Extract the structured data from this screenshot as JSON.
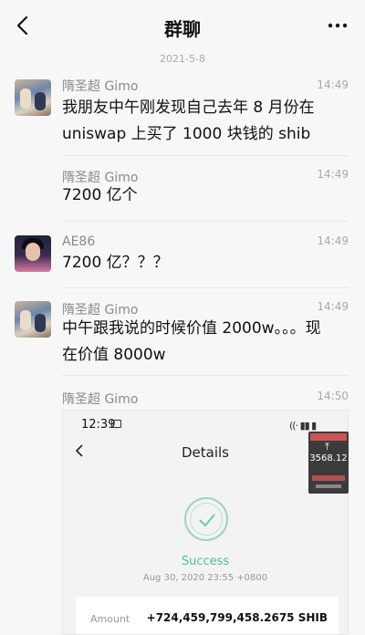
{
  "header": {
    "title": "群聊"
  },
  "date_divider": "2021-5-8",
  "messages": [
    {
      "sender": "隋圣超 Gimo",
      "time": "14:49",
      "lines": [
        "我朋友中午刚发现自己去年 8 月份在",
        "uniswap 上买了 1000 块钱的 shib"
      ]
    },
    {
      "sender": "隋圣超 Gimo",
      "time": "14:49",
      "lines": [
        "7200 亿个"
      ]
    },
    {
      "sender": "AE86",
      "time": "14:49",
      "lines": [
        "7200 亿？？？"
      ]
    },
    {
      "sender": "隋圣超 Gimo",
      "time": "14:49",
      "lines": [
        "中午跟我说的时候价值 2000w。。。现",
        "在价值 8000w"
      ]
    },
    {
      "sender": "隋圣超 Gimo",
      "time": "14:50"
    }
  ],
  "screenshot": {
    "status_time": "12:39",
    "title": "Details",
    "status": "Success",
    "date": "Aug 30, 2020 23:55 +0800",
    "amount_label": "Amount",
    "amount_value": "+724,459,799,458.2675 SHIB",
    "overlay_price": "3568.12"
  }
}
